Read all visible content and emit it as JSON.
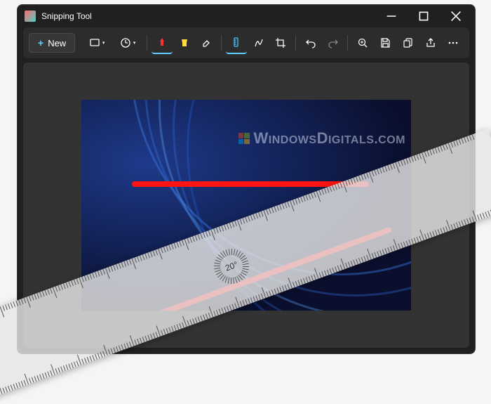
{
  "app": {
    "title": "Snipping Tool"
  },
  "toolbar": {
    "new_label": "New"
  },
  "ruler": {
    "angle_label": "20°"
  },
  "watermark": {
    "text_1": "W",
    "text_2": "INDOWS",
    "text_3": "D",
    "text_4": "IGITALS",
    "text_5": ".",
    "text_6": "COM"
  },
  "annotations": {
    "color": "#ff1414"
  }
}
